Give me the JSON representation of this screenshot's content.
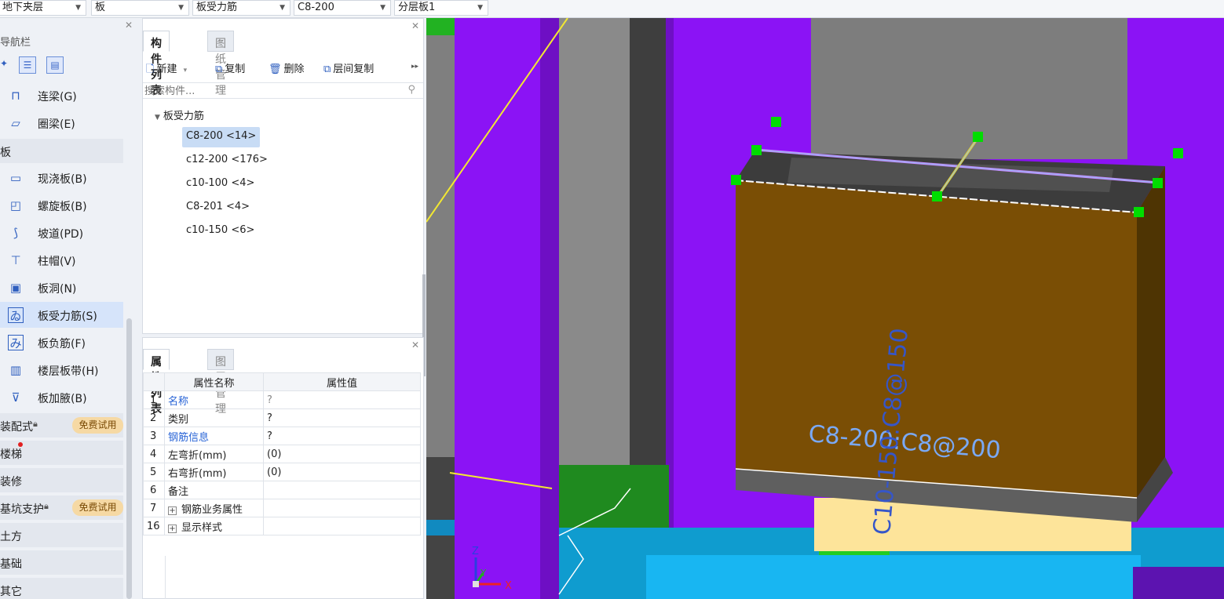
{
  "topbar": {
    "floor": "地下夹层",
    "type": "板",
    "component": "板受力筋",
    "spec": "C8-200",
    "layer": "分层板1"
  },
  "nav": {
    "title": "导航栏",
    "items": [
      {
        "label": "连梁(G)"
      },
      {
        "label": "圈梁(E)"
      }
    ],
    "group_slab": "板",
    "slab_items": [
      {
        "label": "现浇板(B)"
      },
      {
        "label": "螺旋板(B)"
      },
      {
        "label": "坡道(PD)"
      },
      {
        "label": "柱帽(V)"
      },
      {
        "label": "板洞(N)"
      },
      {
        "label": "板受力筋(S)"
      },
      {
        "label": "板负筋(F)"
      },
      {
        "label": "楼层板带(H)"
      },
      {
        "label": "板加腋(B)"
      }
    ],
    "groups": [
      {
        "label": "装配式",
        "badge": "免费试用"
      },
      {
        "label": "楼梯"
      },
      {
        "label": "装修"
      },
      {
        "label": "基坑支护",
        "badge": "免费试用"
      },
      {
        "label": "土方"
      },
      {
        "label": "基础"
      },
      {
        "label": "其它"
      }
    ]
  },
  "comp_panel": {
    "tab_active": "构件列表",
    "tab_other": "图纸管理",
    "new_label": "新建",
    "copy_label": "复制",
    "delete_label": "删除",
    "floor_copy_label": "层间复制",
    "search_placeholder": "搜索构件...",
    "tree_root": "板受力筋",
    "tree_items": [
      {
        "label": "C8-200 <14>"
      },
      {
        "label": "c12-200 <176>"
      },
      {
        "label": "c10-100 <4>"
      },
      {
        "label": "C8-201 <4>"
      },
      {
        "label": "c10-150 <6>"
      }
    ]
  },
  "prop_panel": {
    "tab_active": "属性列表",
    "tab_other": "图层管理",
    "col_name": "属性名称",
    "col_value": "属性值",
    "rows": [
      {
        "num": "1",
        "name": "名称",
        "value": "?"
      },
      {
        "num": "2",
        "name": "类别",
        "value": "?"
      },
      {
        "num": "3",
        "name": "钢筋信息",
        "value": "?"
      },
      {
        "num": "4",
        "name": "左弯折(mm)",
        "value": "(0)"
      },
      {
        "num": "5",
        "name": "右弯折(mm)",
        "value": "(0)"
      },
      {
        "num": "6",
        "name": "备注",
        "value": ""
      },
      {
        "num": "7",
        "name": "钢筋业务属性",
        "value": ""
      },
      {
        "num": "16",
        "name": "显示样式",
        "value": ""
      }
    ]
  },
  "viewport": {
    "label_horizontal": "C8-200:C8@200",
    "label_vertical": "C10-150:C8@150",
    "axis_z": "Z",
    "axis_y": "Y",
    "axis_x": "X"
  }
}
